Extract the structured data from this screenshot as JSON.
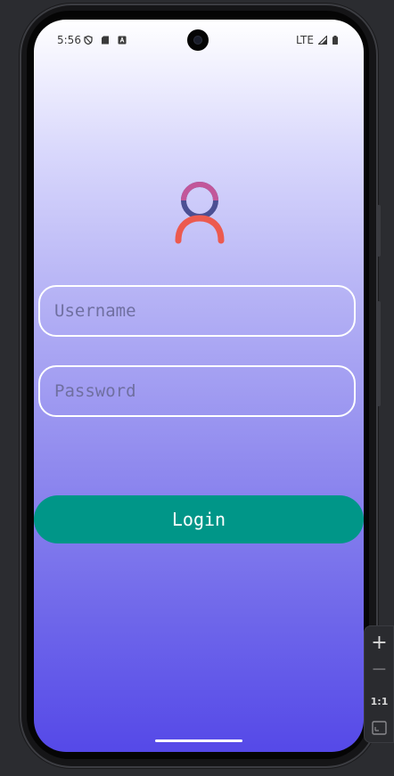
{
  "status_bar": {
    "time": "5:56",
    "network": "LTE"
  },
  "login_form": {
    "username_placeholder": "Username",
    "password_placeholder": "Password",
    "login_label": "Login"
  },
  "colors": {
    "accent": "#009688",
    "gradient_top": "#ffffff",
    "gradient_bottom": "#5549e8",
    "avatar_head": "#c2579a",
    "avatar_head_lower": "#4b4f93",
    "avatar_body": "#ec5a4f"
  },
  "emulator_toolbar": {
    "one_to_one_label": "1:1"
  },
  "icons": [
    "play-protect-icon",
    "sd-card-icon",
    "keyboard-app-icon",
    "signal-icon",
    "battery-icon",
    "user-avatar-icon",
    "zoom-in-icon",
    "zoom-out-icon",
    "fit-screen-icon"
  ]
}
